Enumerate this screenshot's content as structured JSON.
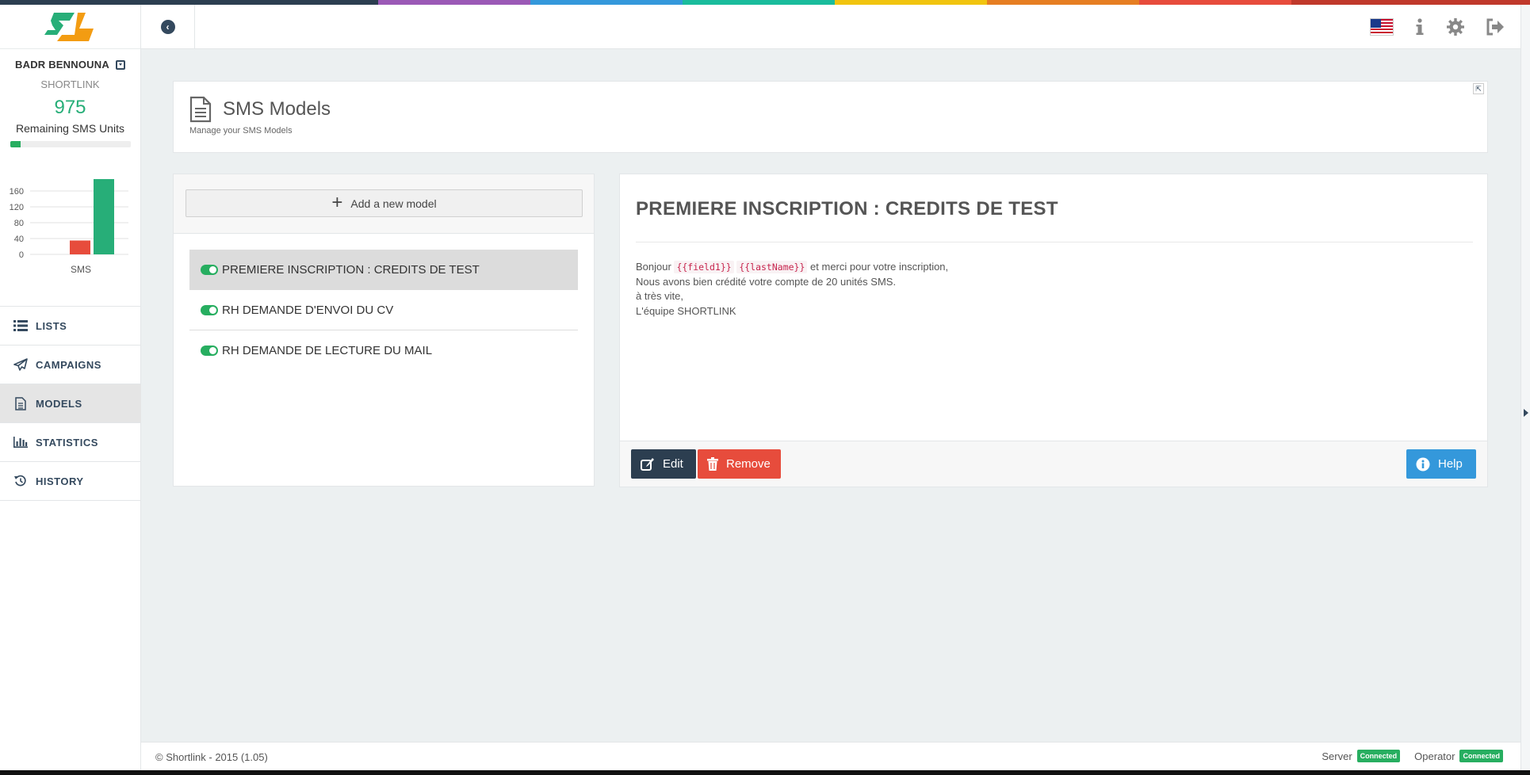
{
  "brand": {
    "logo_alt": "SL",
    "strip_colors": [
      "#2c3e50",
      "#9b59b6",
      "#3498db",
      "#1abc9c",
      "#f1c40f",
      "#e67e22",
      "#e74c3c",
      "#c0392b"
    ]
  },
  "user": {
    "name": "BADR BENNOUNA",
    "company": "SHORTLINK",
    "remaining_units": "975",
    "remaining_label": "Remaining SMS Units",
    "units_progress": 0.09
  },
  "mini_chart": {
    "y_ticks": [
      "160",
      "120",
      "80",
      "40",
      "0"
    ],
    "x_label": "SMS"
  },
  "chart_data": {
    "type": "bar",
    "categories": [
      "SMS"
    ],
    "series": [
      {
        "values": [
          35
        ],
        "color": "#e74c3c"
      },
      {
        "values": [
          190
        ],
        "color": "#27ae78"
      }
    ],
    "ylim": [
      0,
      190
    ],
    "y_ticks": [
      0,
      40,
      80,
      120,
      160
    ]
  },
  "nav": [
    {
      "label": "LISTS",
      "icon": "list-icon"
    },
    {
      "label": "CAMPAIGNS",
      "icon": "paper-plane-icon"
    },
    {
      "label": "MODELS",
      "icon": "document-icon",
      "active": true
    },
    {
      "label": "STATISTICS",
      "icon": "bar-chart-icon"
    },
    {
      "label": "HISTORY",
      "icon": "history-icon"
    }
  ],
  "header": {
    "icons": [
      "us-flag-icon",
      "info-icon",
      "gear-icon",
      "logout-icon"
    ]
  },
  "page": {
    "title": "SMS Models",
    "subtitle": "Manage your SMS Models"
  },
  "list": {
    "add_label": "Add a new model",
    "items": [
      {
        "label": "PREMIERE INSCRIPTION : CREDITS DE TEST",
        "selected": true,
        "enabled": true
      },
      {
        "label": "RH DEMANDE D'ENVOI DU CV",
        "selected": false,
        "enabled": true
      },
      {
        "label": "RH DEMANDE DE LECTURE DU MAIL",
        "selected": false,
        "enabled": true
      }
    ]
  },
  "detail": {
    "title": "PREMIERE INSCRIPTION : CREDITS DE TEST",
    "line1_start": "Bonjour",
    "var1": "{{field1}}",
    "var2": "{{lastName}}",
    "line1_end": "et merci pour votre inscription,",
    "line2": "Nous avons bien crédité votre compte de 20 unités SMS.",
    "line3": "à très vite,",
    "line4": "L'équipe SHORTLINK",
    "edit_label": "Edit",
    "remove_label": "Remove",
    "help_label": "Help"
  },
  "footer": {
    "copyright": "© Shortlink - 2015 (1.05)",
    "server_label": "Server",
    "server_status": "Connected",
    "operator_label": "Operator",
    "operator_status": "Connected"
  }
}
